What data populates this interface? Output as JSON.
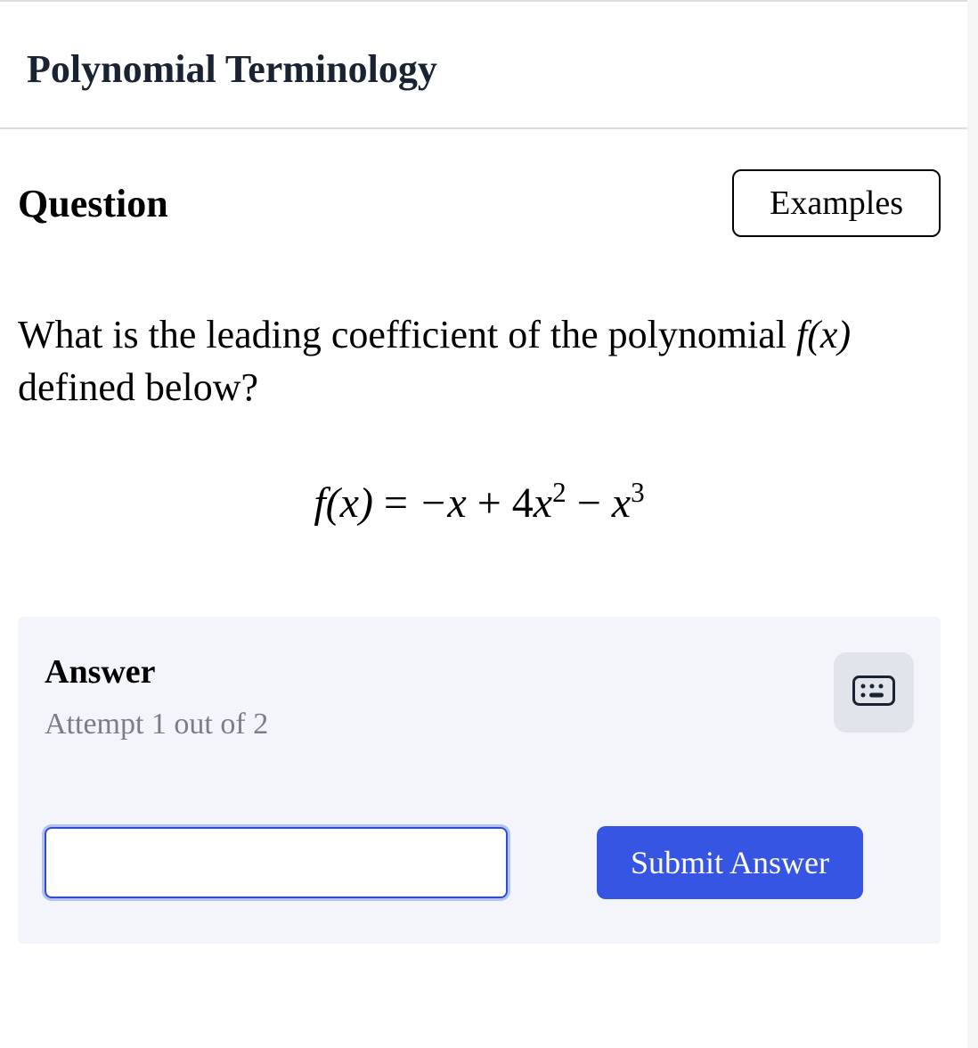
{
  "header": {
    "title": "Polynomial Terminology"
  },
  "question": {
    "heading": "Question",
    "examples_label": "Examples",
    "prompt_pre": "What is the leading coefficient of the polynomial ",
    "prompt_fx": "f(x)",
    "prompt_post": " defined below?"
  },
  "equation": {
    "lhs": "f(x)",
    "eq": " = ",
    "t1": "−x",
    "op1": " + ",
    "t2c": "4",
    "t2v": "x",
    "t2e": "2",
    "op2": " − ",
    "t3v": "x",
    "t3e": "3"
  },
  "answer": {
    "heading": "Answer",
    "attempt": "Attempt 1 out of 2",
    "input_value": "",
    "submit_label": "Submit Answer"
  }
}
